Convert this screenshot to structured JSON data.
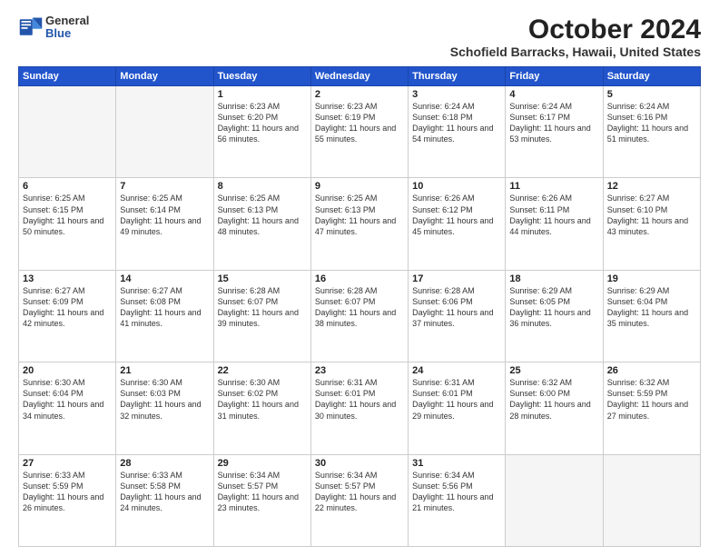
{
  "header": {
    "logo_general": "General",
    "logo_blue": "Blue",
    "title": "October 2024",
    "subtitle": "Schofield Barracks, Hawaii, United States"
  },
  "days_of_week": [
    "Sunday",
    "Monday",
    "Tuesday",
    "Wednesday",
    "Thursday",
    "Friday",
    "Saturday"
  ],
  "weeks": [
    [
      {
        "day": "",
        "detail": ""
      },
      {
        "day": "",
        "detail": ""
      },
      {
        "day": "1",
        "detail": "Sunrise: 6:23 AM\nSunset: 6:20 PM\nDaylight: 11 hours and 56 minutes."
      },
      {
        "day": "2",
        "detail": "Sunrise: 6:23 AM\nSunset: 6:19 PM\nDaylight: 11 hours and 55 minutes."
      },
      {
        "day": "3",
        "detail": "Sunrise: 6:24 AM\nSunset: 6:18 PM\nDaylight: 11 hours and 54 minutes."
      },
      {
        "day": "4",
        "detail": "Sunrise: 6:24 AM\nSunset: 6:17 PM\nDaylight: 11 hours and 53 minutes."
      },
      {
        "day": "5",
        "detail": "Sunrise: 6:24 AM\nSunset: 6:16 PM\nDaylight: 11 hours and 51 minutes."
      }
    ],
    [
      {
        "day": "6",
        "detail": "Sunrise: 6:25 AM\nSunset: 6:15 PM\nDaylight: 11 hours and 50 minutes."
      },
      {
        "day": "7",
        "detail": "Sunrise: 6:25 AM\nSunset: 6:14 PM\nDaylight: 11 hours and 49 minutes."
      },
      {
        "day": "8",
        "detail": "Sunrise: 6:25 AM\nSunset: 6:13 PM\nDaylight: 11 hours and 48 minutes."
      },
      {
        "day": "9",
        "detail": "Sunrise: 6:25 AM\nSunset: 6:13 PM\nDaylight: 11 hours and 47 minutes."
      },
      {
        "day": "10",
        "detail": "Sunrise: 6:26 AM\nSunset: 6:12 PM\nDaylight: 11 hours and 45 minutes."
      },
      {
        "day": "11",
        "detail": "Sunrise: 6:26 AM\nSunset: 6:11 PM\nDaylight: 11 hours and 44 minutes."
      },
      {
        "day": "12",
        "detail": "Sunrise: 6:27 AM\nSunset: 6:10 PM\nDaylight: 11 hours and 43 minutes."
      }
    ],
    [
      {
        "day": "13",
        "detail": "Sunrise: 6:27 AM\nSunset: 6:09 PM\nDaylight: 11 hours and 42 minutes."
      },
      {
        "day": "14",
        "detail": "Sunrise: 6:27 AM\nSunset: 6:08 PM\nDaylight: 11 hours and 41 minutes."
      },
      {
        "day": "15",
        "detail": "Sunrise: 6:28 AM\nSunset: 6:07 PM\nDaylight: 11 hours and 39 minutes."
      },
      {
        "day": "16",
        "detail": "Sunrise: 6:28 AM\nSunset: 6:07 PM\nDaylight: 11 hours and 38 minutes."
      },
      {
        "day": "17",
        "detail": "Sunrise: 6:28 AM\nSunset: 6:06 PM\nDaylight: 11 hours and 37 minutes."
      },
      {
        "day": "18",
        "detail": "Sunrise: 6:29 AM\nSunset: 6:05 PM\nDaylight: 11 hours and 36 minutes."
      },
      {
        "day": "19",
        "detail": "Sunrise: 6:29 AM\nSunset: 6:04 PM\nDaylight: 11 hours and 35 minutes."
      }
    ],
    [
      {
        "day": "20",
        "detail": "Sunrise: 6:30 AM\nSunset: 6:04 PM\nDaylight: 11 hours and 34 minutes."
      },
      {
        "day": "21",
        "detail": "Sunrise: 6:30 AM\nSunset: 6:03 PM\nDaylight: 11 hours and 32 minutes."
      },
      {
        "day": "22",
        "detail": "Sunrise: 6:30 AM\nSunset: 6:02 PM\nDaylight: 11 hours and 31 minutes."
      },
      {
        "day": "23",
        "detail": "Sunrise: 6:31 AM\nSunset: 6:01 PM\nDaylight: 11 hours and 30 minutes."
      },
      {
        "day": "24",
        "detail": "Sunrise: 6:31 AM\nSunset: 6:01 PM\nDaylight: 11 hours and 29 minutes."
      },
      {
        "day": "25",
        "detail": "Sunrise: 6:32 AM\nSunset: 6:00 PM\nDaylight: 11 hours and 28 minutes."
      },
      {
        "day": "26",
        "detail": "Sunrise: 6:32 AM\nSunset: 5:59 PM\nDaylight: 11 hours and 27 minutes."
      }
    ],
    [
      {
        "day": "27",
        "detail": "Sunrise: 6:33 AM\nSunset: 5:59 PM\nDaylight: 11 hours and 26 minutes."
      },
      {
        "day": "28",
        "detail": "Sunrise: 6:33 AM\nSunset: 5:58 PM\nDaylight: 11 hours and 24 minutes."
      },
      {
        "day": "29",
        "detail": "Sunrise: 6:34 AM\nSunset: 5:57 PM\nDaylight: 11 hours and 23 minutes."
      },
      {
        "day": "30",
        "detail": "Sunrise: 6:34 AM\nSunset: 5:57 PM\nDaylight: 11 hours and 22 minutes."
      },
      {
        "day": "31",
        "detail": "Sunrise: 6:34 AM\nSunset: 5:56 PM\nDaylight: 11 hours and 21 minutes."
      },
      {
        "day": "",
        "detail": ""
      },
      {
        "day": "",
        "detail": ""
      }
    ]
  ]
}
